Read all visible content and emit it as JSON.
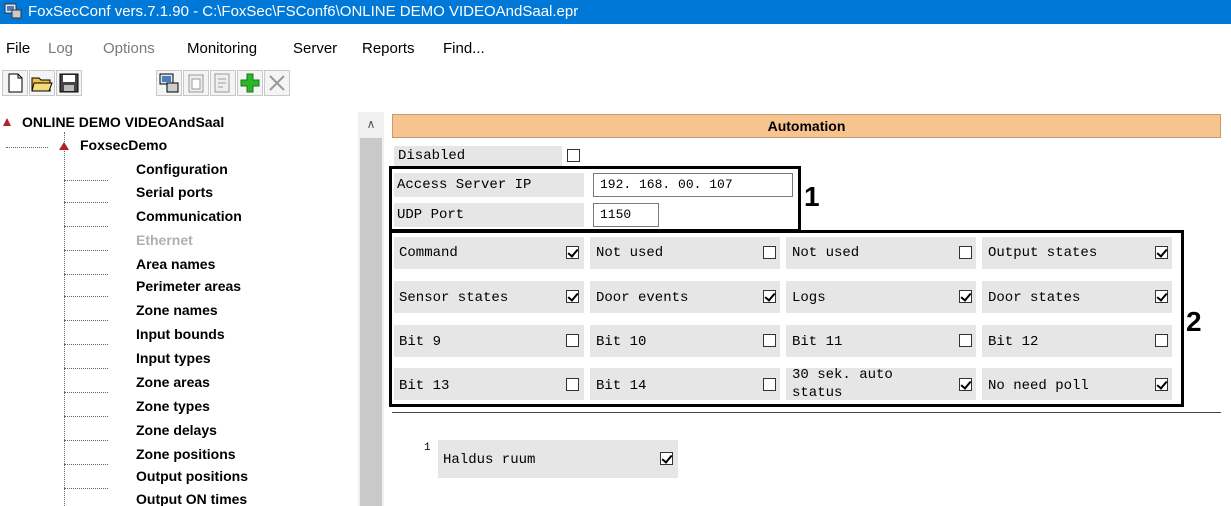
{
  "window": {
    "title": "FoxSecConf vers.7.1.90 - C:\\FoxSec\\FSConf6\\ONLINE DEMO VIDEOAndSaal.epr"
  },
  "menu": [
    {
      "label": "File",
      "enabled": true
    },
    {
      "label": "Log",
      "enabled": false
    },
    {
      "label": "Options",
      "enabled": false
    },
    {
      "label": "Monitoring",
      "enabled": true
    },
    {
      "label": "Server",
      "enabled": true
    },
    {
      "label": "Reports",
      "enabled": true
    },
    {
      "label": "Find...",
      "enabled": true
    }
  ],
  "toolbar": {
    "icons": [
      "new-file-icon",
      "open-folder-icon",
      "save-icon",
      "computer-icon",
      "paste-icon",
      "properties-icon",
      "add-icon",
      "delete-icon"
    ]
  },
  "tree": {
    "root": "ONLINE DEMO VIDEOAndSaal",
    "device": "FoxsecDemo",
    "items": [
      {
        "label": "Configuration",
        "enabled": true
      },
      {
        "label": "Serial ports",
        "enabled": true
      },
      {
        "label": "Communication",
        "enabled": true
      },
      {
        "label": "Ethernet",
        "enabled": false
      },
      {
        "label": "Area names",
        "enabled": true
      },
      {
        "label": "Perimeter areas",
        "enabled": true
      },
      {
        "label": "Zone names",
        "enabled": true
      },
      {
        "label": "Input bounds",
        "enabled": true
      },
      {
        "label": "Input types",
        "enabled": true
      },
      {
        "label": "Zone areas",
        "enabled": true
      },
      {
        "label": "Zone types",
        "enabled": true
      },
      {
        "label": "Zone delays",
        "enabled": true
      },
      {
        "label": "Zone positions",
        "enabled": true
      },
      {
        "label": "Output positions",
        "enabled": true
      },
      {
        "label": "Output ON times",
        "enabled": true
      }
    ]
  },
  "panel": {
    "header": "Automation",
    "disabled_label": "Disabled",
    "disabled_checked": false,
    "access_server_ip_label": "Access Server IP",
    "access_server_ip_value": "192. 168.  00. 107",
    "udp_port_label": "UDP Port",
    "udp_port_value": "1150",
    "flags": [
      {
        "label": "Command",
        "checked": true
      },
      {
        "label": "Not used",
        "checked": false
      },
      {
        "label": "Not used",
        "checked": false
      },
      {
        "label": "Output states",
        "checked": true
      },
      {
        "label": "Sensor states",
        "checked": true
      },
      {
        "label": "Door events",
        "checked": true
      },
      {
        "label": "Logs",
        "checked": true
      },
      {
        "label": "Door states",
        "checked": true
      },
      {
        "label": "Bit 9",
        "checked": false
      },
      {
        "label": "Bit 10",
        "checked": false
      },
      {
        "label": "Bit 11",
        "checked": false
      },
      {
        "label": "Bit 12",
        "checked": false
      },
      {
        "label": "Bit 13",
        "checked": false
      },
      {
        "label": "Bit 14",
        "checked": false
      },
      {
        "label": "30 sek. auto status",
        "checked": true
      },
      {
        "label": "No need poll",
        "checked": true
      }
    ],
    "annotation_1": "1",
    "annotation_2": "2",
    "area_index": "1",
    "area_label": "Haldus ruum",
    "area_checked": true
  }
}
